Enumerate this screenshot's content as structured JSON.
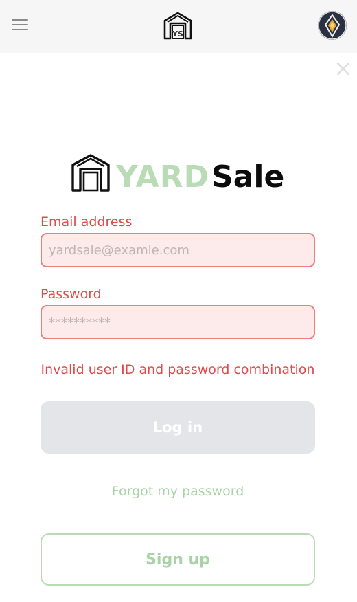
{
  "header": {
    "menu_icon": "hamburger-icon",
    "logo_icon": "yard-sale-logo-icon",
    "logo_text": "YS",
    "avatar_icon": "user-avatar-icon"
  },
  "dialog": {
    "close_icon": "close-icon",
    "brand": {
      "word1": "YARD",
      "word2": "Sale"
    },
    "email": {
      "label": "Email address",
      "value": "",
      "placeholder": "yardsale@examle.com"
    },
    "password": {
      "label": "Password",
      "value": "",
      "placeholder": "**********"
    },
    "error": "Invalid user ID and password combination",
    "login_label": "Log in",
    "forgot_label": "Forgot my password",
    "signup_label": "Sign up"
  },
  "colors": {
    "accent_green": "#b9dcb6",
    "error_red": "#e04a4a",
    "input_bg": "#fdeaea",
    "disabled_button": "#e4e5e9",
    "topbar_bg": "#f6f6f6"
  }
}
